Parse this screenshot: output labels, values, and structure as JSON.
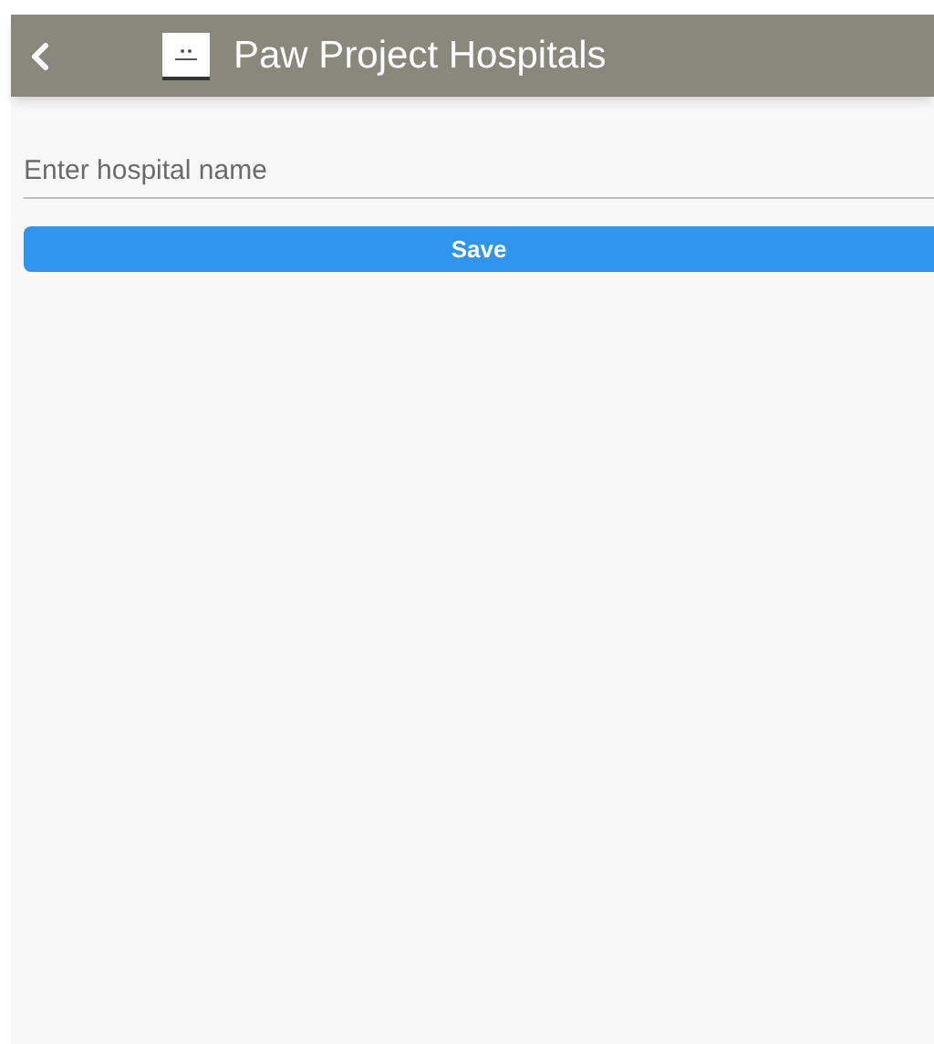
{
  "header": {
    "title": "Paw Project Hospitals"
  },
  "form": {
    "hospital_name": {
      "placeholder": "Enter hospital name"
    },
    "save_button": "Save"
  }
}
